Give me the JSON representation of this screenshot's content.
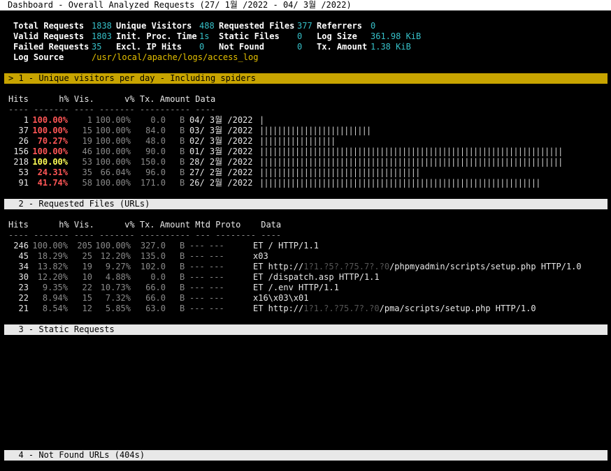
{
  "title": "Dashboard - Overall Analyzed Requests (27/ 1월 /2022 - 04/ 3월 /2022)",
  "overview": {
    "total_requests_label": "Total Requests",
    "total_requests": "1838",
    "unique_visitors_label": "Unique Visitors",
    "unique_visitors": "488",
    "requested_files_label": "Requested Files",
    "requested_files": "377",
    "referrers_label": "Referrers",
    "referrers": "0",
    "valid_requests_label": "Valid Requests",
    "valid_requests": "1803",
    "init_proc_label": "Init. Proc. Time",
    "init_proc": "1s",
    "static_files_label": "Static Files",
    "static_files": "0",
    "log_size_label": "Log Size",
    "log_size": "361.98 KiB",
    "failed_requests_label": "Failed Requests",
    "failed_requests": "35",
    "excl_ip_label": "Excl. IP Hits",
    "excl_ip": "0",
    "not_found_label": "Not Found",
    "not_found": "0",
    "tx_amount_label": "Tx. Amount",
    "tx_amount": "1.38 KiB",
    "log_source_label": "Log Source",
    "log_source": "/usr/local/apache/logs/access_log"
  },
  "panel1": {
    "header": "> 1 - Unique visitors per day - Including spiders",
    "columns": "Hits      h% Vis.      v% Tx. Amount Data",
    "separator": "---- ------- ---- ------- ---------- ----",
    "rows": [
      {
        "hits": "1",
        "hpct": "100.00%",
        "hcolor": "red",
        "vis": "1",
        "vpct": "100.00%",
        "tx": "0.0",
        "unit": "B",
        "date": "04/ 3월 /2022",
        "bar": 1
      },
      {
        "hits": "37",
        "hpct": "100.00%",
        "hcolor": "red",
        "vis": "15",
        "vpct": "100.00%",
        "tx": "84.0",
        "unit": "B",
        "date": "03/ 3월 /2022",
        "bar": 25
      },
      {
        "hits": "26",
        "hpct": "70.27%",
        "hcolor": "red",
        "vis": "19",
        "vpct": "100.00%",
        "tx": "48.0",
        "unit": "B",
        "date": "02/ 3월 /2022",
        "bar": 17
      },
      {
        "hits": "156",
        "hpct": "100.00%",
        "hcolor": "red",
        "vis": "46",
        "vpct": "100.00%",
        "tx": "90.0",
        "unit": "B",
        "date": "01/ 3월 /2022",
        "bar": 68
      },
      {
        "hits": "218",
        "hpct": "100.00%",
        "hcolor": "bright",
        "vis": "53",
        "vpct": "100.00%",
        "tx": "150.0",
        "unit": "B",
        "date": "28/ 2월 /2022",
        "bar": 68
      },
      {
        "hits": "53",
        "hpct": "24.31%",
        "hcolor": "red",
        "vis": "35",
        "vpct": "66.04%",
        "tx": "96.0",
        "unit": "B",
        "date": "27/ 2월 /2022",
        "bar": 36
      },
      {
        "hits": "91",
        "hpct": "41.74%",
        "hcolor": "red",
        "vis": "58",
        "vpct": "100.00%",
        "tx": "171.0",
        "unit": "B",
        "date": "26/ 2월 /2022",
        "bar": 63
      }
    ]
  },
  "panel2": {
    "header": "  2 - Requested Files (URLs)",
    "columns": "Hits      h% Vis.      v% Tx. Amount Mtd Proto    Data",
    "separator": "---- ------- ---- ------- ---------- --- -------- ----",
    "rows": [
      {
        "hits": "246",
        "hpct": "100.00%",
        "vis": "205",
        "vpct": "100.00%",
        "tx": "327.0",
        "unit": "B",
        "mtd": "---",
        "proto": "---",
        "data_a": "ET / HTTP/1.1",
        "data_m": "",
        "data_b": ""
      },
      {
        "hits": "45",
        "hpct": "18.29%",
        "vis": "25",
        "vpct": "12.20%",
        "tx": "135.0",
        "unit": "B",
        "mtd": "---",
        "proto": "---",
        "data_a": "x03",
        "data_m": "",
        "data_b": ""
      },
      {
        "hits": "34",
        "hpct": "13.82%",
        "vis": "19",
        "vpct": "9.27%",
        "tx": "102.0",
        "unit": "B",
        "mtd": "---",
        "proto": "---",
        "data_a": "ET http://",
        "data_m": "1?1.?5?.?75.7?.?0",
        "data_b": "/phpmyadmin/scripts/setup.php HTTP/1.0"
      },
      {
        "hits": "30",
        "hpct": "12.20%",
        "vis": "10",
        "vpct": "4.88%",
        "tx": "0.0",
        "unit": "B",
        "mtd": "---",
        "proto": "---",
        "data_a": "ET /dispatch.asp HTTP/1.1",
        "data_m": "",
        "data_b": ""
      },
      {
        "hits": "23",
        "hpct": "9.35%",
        "vis": "22",
        "vpct": "10.73%",
        "tx": "66.0",
        "unit": "B",
        "mtd": "---",
        "proto": "---",
        "data_a": "ET /.env HTTP/1.1",
        "data_m": "",
        "data_b": ""
      },
      {
        "hits": "22",
        "hpct": "8.94%",
        "vis": "15",
        "vpct": "7.32%",
        "tx": "66.0",
        "unit": "B",
        "mtd": "---",
        "proto": "---",
        "data_a": "x16\\x03\\x01",
        "data_m": "",
        "data_b": ""
      },
      {
        "hits": "21",
        "hpct": "8.54%",
        "vis": "12",
        "vpct": "5.85%",
        "tx": "63.0",
        "unit": "B",
        "mtd": "---",
        "proto": "---",
        "data_a": "ET http://",
        "data_m": "1?1.?.?75.7?.?0",
        "data_b": "/pma/scripts/setup.php HTTP/1.0"
      }
    ]
  },
  "panel3": {
    "header": "  3 - Static Requests"
  },
  "panel4": {
    "header": "  4 - Not Found URLs (404s)"
  }
}
